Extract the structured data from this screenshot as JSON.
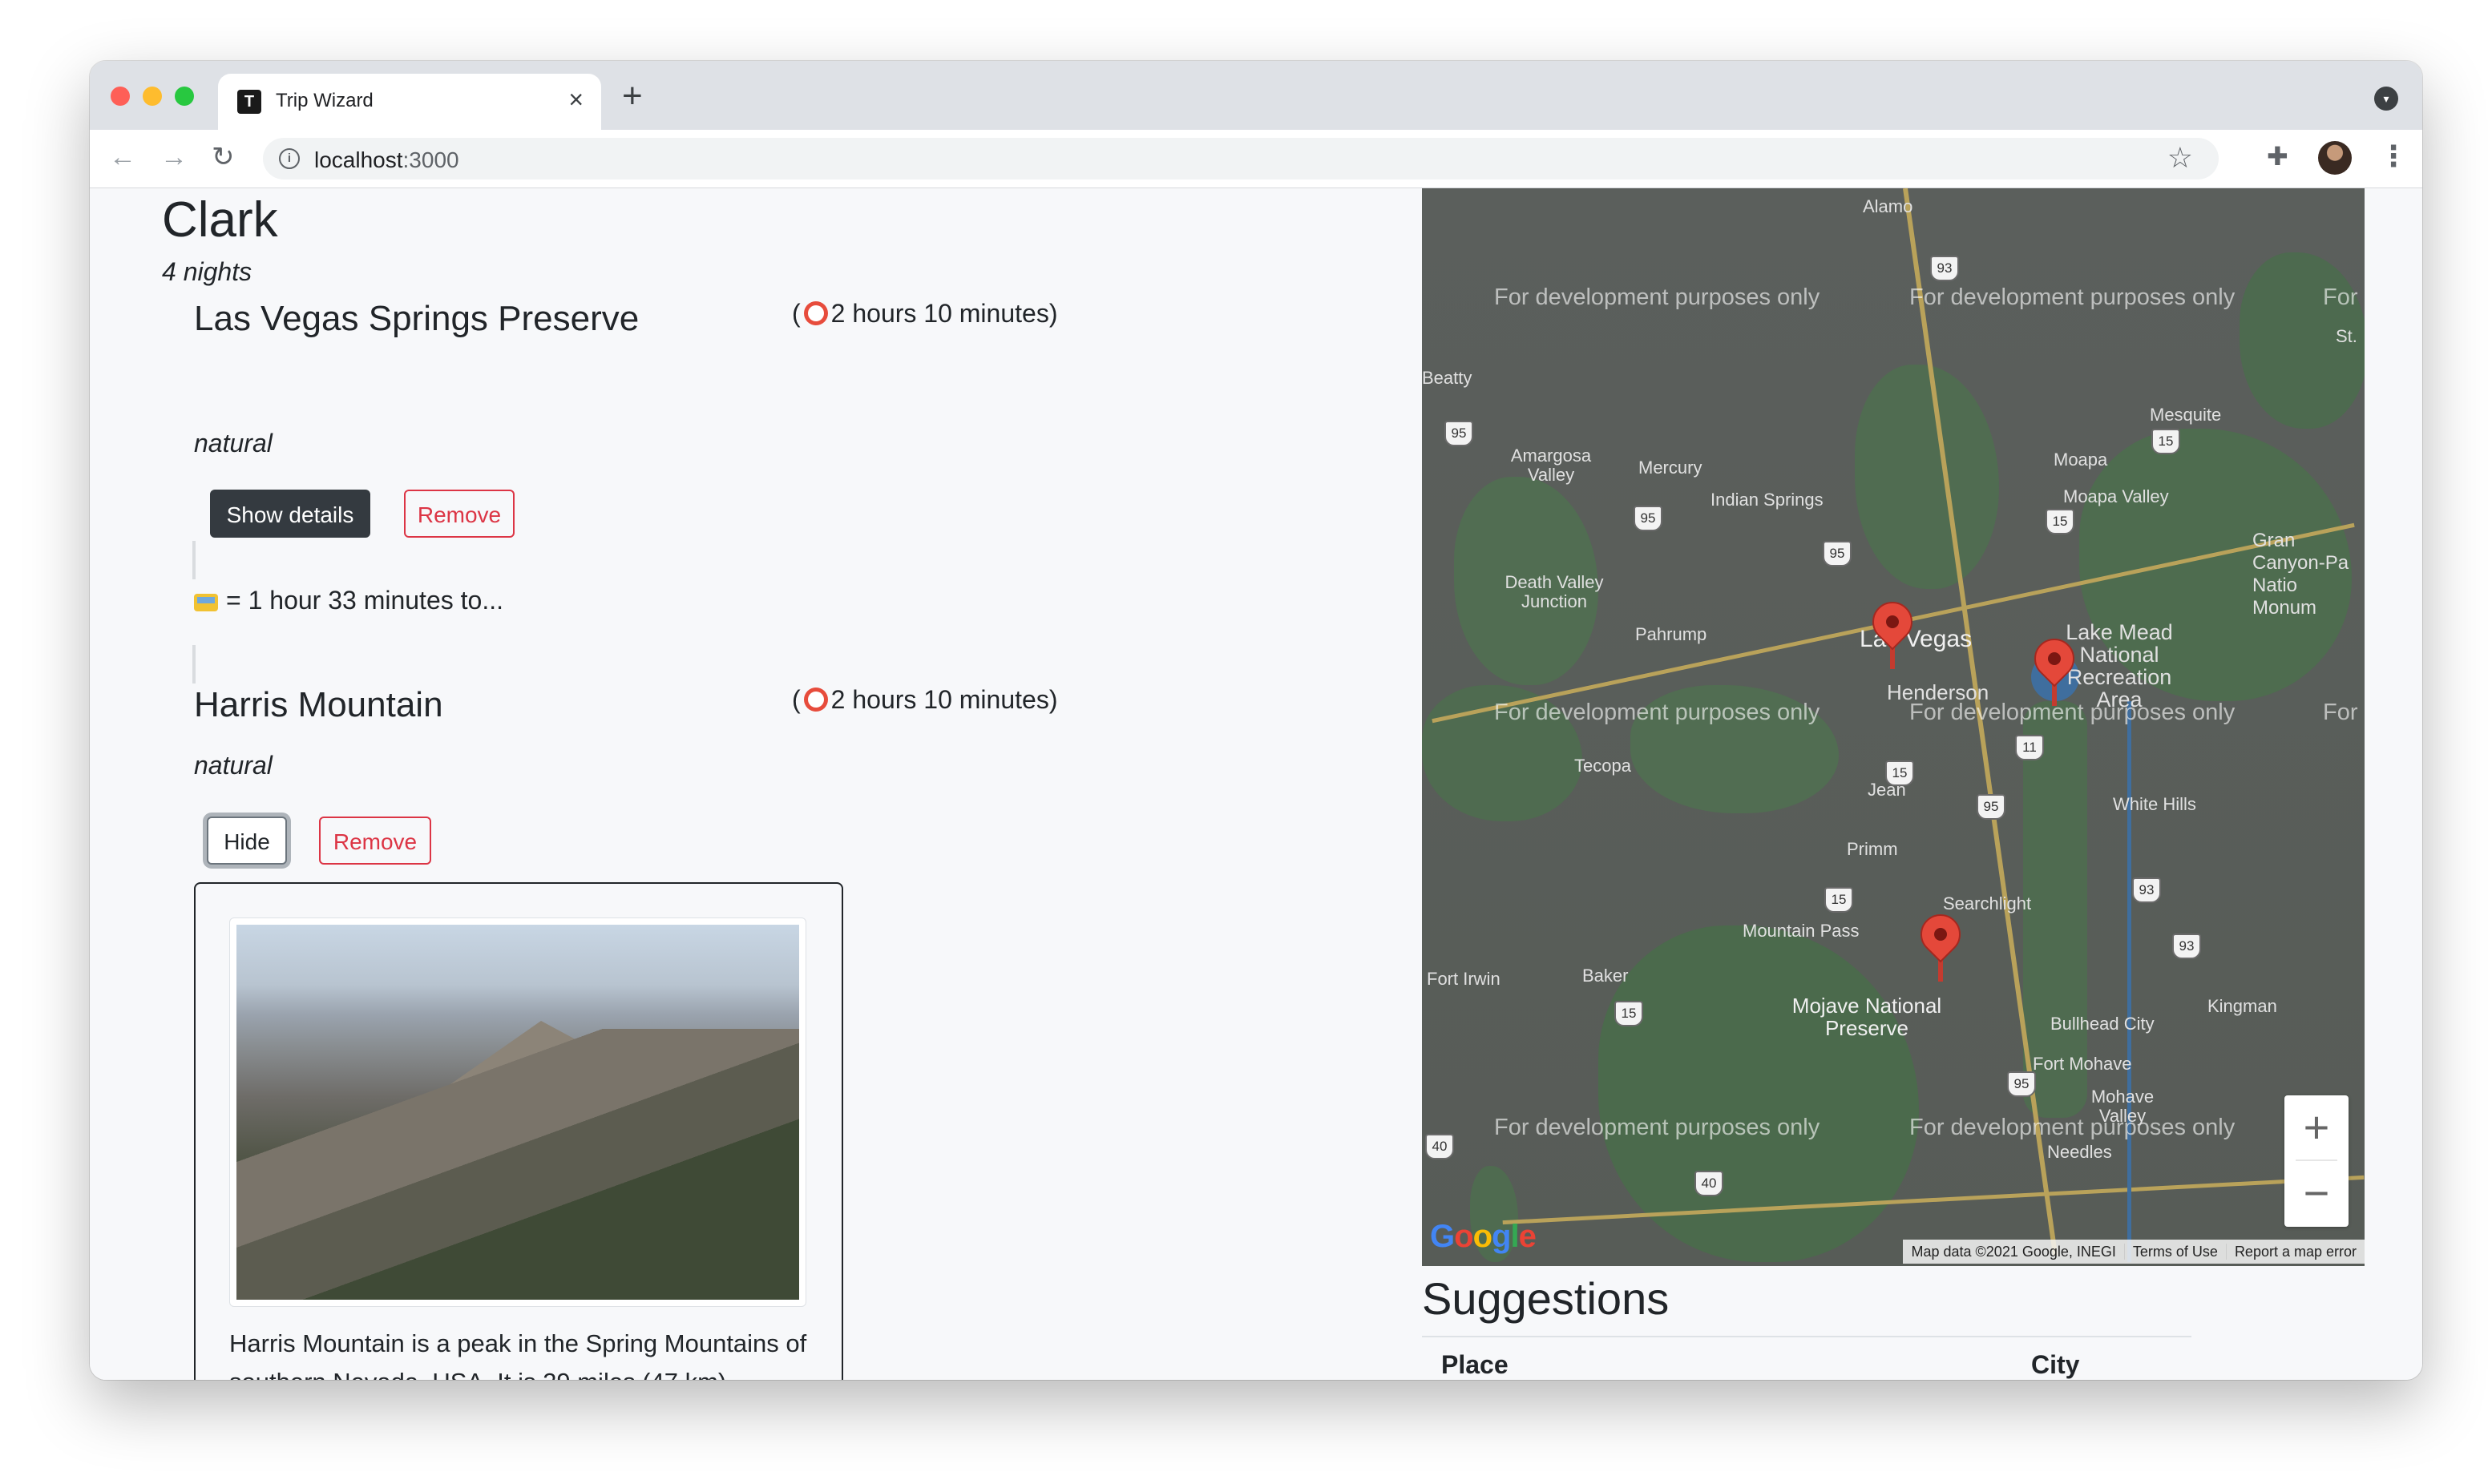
{
  "browser": {
    "tab_title": "Trip Wizard",
    "tab_close": "×",
    "new_tab": "+",
    "url_host": "localhost",
    "url_port": ":3000",
    "favicon_letter": "T"
  },
  "trip": {
    "city": "Clark",
    "nights": "4 nights",
    "places": [
      {
        "name": "Las Vegas Springs Preserve",
        "duration_prefix": "(",
        "duration": "2 hours 10 minutes)",
        "category": "natural",
        "details_button": "Show details",
        "remove_button": "Remove"
      },
      {
        "name": "Harris Mountain",
        "duration_prefix": "(",
        "duration": "2 hours 10 minutes)",
        "category": "natural",
        "details_button": "Hide",
        "remove_button": "Remove",
        "description": "Harris Mountain is a peak in the Spring Mountains of southern Nevada, USA. It is 29 miles (47 km) northwest of the Las Vegas Strip. It"
      }
    ],
    "travel": "= 1 hour 33 minutes to..."
  },
  "map": {
    "watermark": "For development purposes only",
    "watermark_partial": "For",
    "zoom_in": "+",
    "zoom_out": "−",
    "google": "Google",
    "footer": [
      "Map data ©2021 Google, INEGI",
      "Terms of Use",
      "Report a map error"
    ],
    "labels": {
      "alamo": "Alamo",
      "beatty": "Beatty",
      "amargosa": "Amargosa Valley",
      "mercury": "Mercury",
      "indian_springs": "Indian Springs",
      "mesquite": "Mesquite",
      "moapa": "Moapa",
      "moapa_valley": "Moapa Valley",
      "death_valley": "Death Valley Junction",
      "pahrump": "Pahrump",
      "las_vegas": "Las Vegas",
      "henderson": "Henderson",
      "lake_mead": "Lake Mead National Recreation Area",
      "tecopa": "Tecopa",
      "jean": "Jean",
      "white_hills": "White Hills",
      "primm": "Primm",
      "searchlight": "Searchlight",
      "mountain_pass": "Mountain Pass",
      "fort_irwin": "Fort Irwin",
      "baker": "Baker",
      "mojave": "Mojave National Preserve",
      "bullhead": "Bullhead City",
      "kingman": "Kingman",
      "fort_mohave": "Fort Mohave",
      "mohave_valley": "Mohave Valley",
      "needles": "Needles",
      "grand_canyon": "Gran Canyon-Pa Natio Monum",
      "st": "St."
    }
  },
  "suggestions": {
    "title": "Suggestions",
    "col_place": "Place",
    "col_city": "City"
  }
}
